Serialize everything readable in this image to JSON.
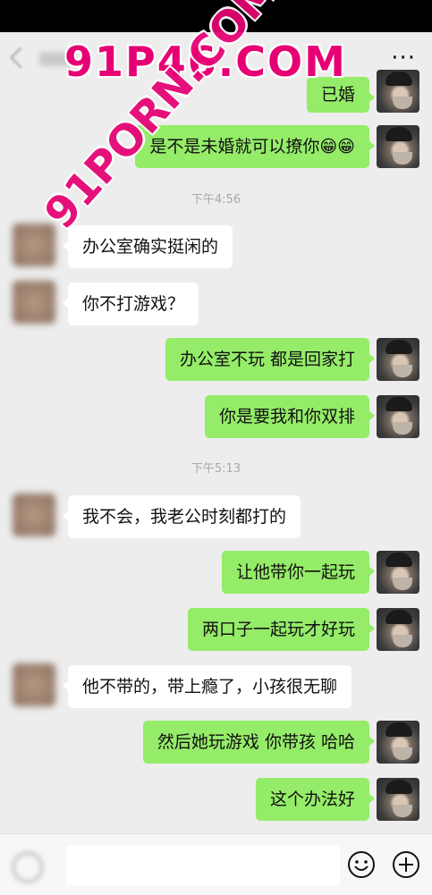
{
  "watermarks": {
    "top": "91P46.COM",
    "diagonal": "91PORN.COM"
  },
  "header": {
    "more_label": "···"
  },
  "messages": [
    {
      "side": "out",
      "text": "已婚"
    },
    {
      "side": "out",
      "text": "是不是未婚就可以撩你😁😁"
    },
    {
      "type": "time",
      "text": "下午4:56"
    },
    {
      "side": "in",
      "text": "办公室确实挺闲的"
    },
    {
      "side": "in",
      "text": "你不打游戏？"
    },
    {
      "side": "out",
      "text": "办公室不玩 都是回家打"
    },
    {
      "side": "out",
      "text": "你是要我和你双排"
    },
    {
      "type": "time",
      "text": "下午5:13"
    },
    {
      "side": "in",
      "text": "我不会，我老公时刻都打的"
    },
    {
      "side": "out",
      "text": "让他带你一起玩"
    },
    {
      "side": "out",
      "text": "两口子一起玩才好玩"
    },
    {
      "side": "in",
      "text": "他不带的，带上瘾了，小孩很无聊"
    },
    {
      "side": "out",
      "text": "然后她玩游戏 你带孩 哈哈"
    },
    {
      "side": "out",
      "text": "这个办法好"
    }
  ],
  "icons": {
    "back": "chevron-left-icon",
    "more": "more-icon",
    "voice": "voice-icon",
    "emoji": "emoji-icon",
    "plus": "plus-icon"
  },
  "colors": {
    "outgoing_bubble": "#95ec69",
    "incoming_bubble": "#ffffff",
    "background": "#ededed",
    "watermark": "#e60073"
  }
}
